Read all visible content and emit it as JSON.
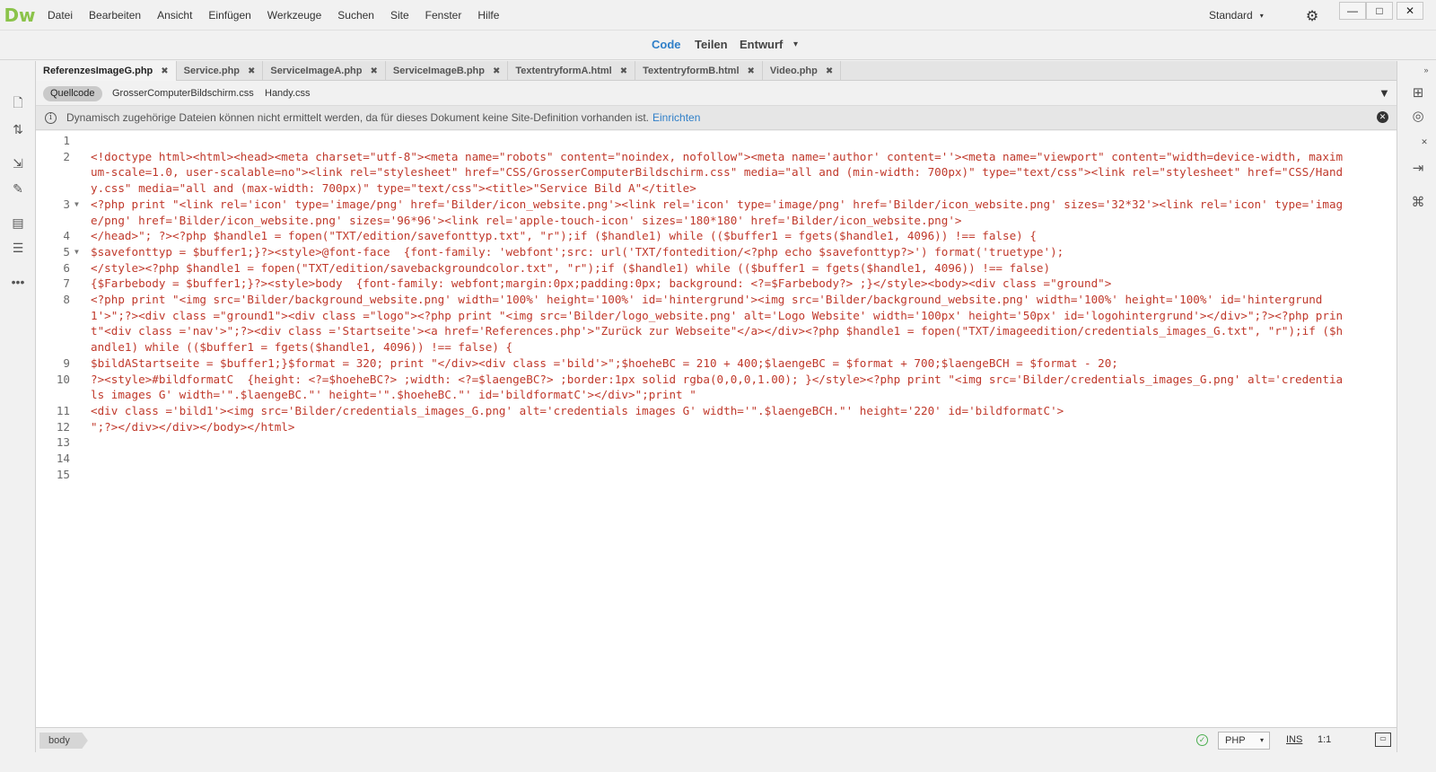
{
  "app": {
    "logo": "Dw"
  },
  "menu": [
    "Datei",
    "Bearbeiten",
    "Ansicht",
    "Einfügen",
    "Werkzeuge",
    "Suchen",
    "Site",
    "Fenster",
    "Hilfe"
  ],
  "workspace": {
    "label": "Standard",
    "caret": "▾"
  },
  "window_controls": {
    "minimize": "—",
    "maximize": "□",
    "close": "✕"
  },
  "view_modes": {
    "code": "Code",
    "split": "Teilen",
    "design": "Entwurf",
    "caret": "▾"
  },
  "tabs": [
    {
      "label": "ReferenzesImageG.php",
      "active": true
    },
    {
      "label": "Service.php"
    },
    {
      "label": "ServiceImageA.php"
    },
    {
      "label": "ServiceImageB.php"
    },
    {
      "label": "TextentryformA.html"
    },
    {
      "label": "TextentryformB.html"
    },
    {
      "label": "Video.php"
    }
  ],
  "related_files": [
    {
      "label": "Quellcode",
      "active": true
    },
    {
      "label": "GrosserComputerBildschirm.css"
    },
    {
      "label": "Handy.css"
    }
  ],
  "info_bar": {
    "message": "Dynamisch zugehörige Dateien können nicht ermittelt werden, da für dieses Dokument keine Site-Definition vorhanden ist.",
    "link": "Einrichten"
  },
  "code_lines": [
    {
      "n": "1",
      "text": ""
    },
    {
      "n": "2",
      "text": "<!doctype html><html><head><meta charset=\"utf-8\"><meta name=\"robots\" content=\"noindex, nofollow\"><meta name='author' content=''><meta name=\"viewport\" content=\"width=device-width, maximum-scale=1.0, user-scalable=no\"><link rel=\"stylesheet\" href=\"CSS/GrosserComputerBildschirm.css\" media=\"all and (min-width: 700px)\" type=\"text/css\"><link rel=\"stylesheet\" href=\"CSS/Handy.css\" media=\"all and (max-width: 700px)\" type=\"text/css\"><title>\"Service Bild A\"</title>"
    },
    {
      "n": "3",
      "text": "<?php print \"<link rel='icon' type='image/png' href='Bilder/icon_website.png'><link rel='icon' type='image/png' href='Bilder/icon_website.png' sizes='32*32'><link rel='icon' type='image/png' href='Bilder/icon_website.png' sizes='96*96'><link rel='apple-touch-icon' sizes='180*180' href='Bilder/icon_website.png'>"
    },
    {
      "n": "4",
      "text": "</head>\"; ?><?php $handle1 = fopen(\"TXT/edition/savefonttyp.txt\", \"r\");if ($handle1) while (($buffer1 = fgets($handle1, 4096)) !== false) {"
    },
    {
      "n": "5",
      "text": "$savefonttyp = $buffer1;}?><style>@font-face  {font-family: 'webfont';src: url('TXT/fontedition/<?php echo $savefonttyp?>') format('truetype');"
    },
    {
      "n": "6",
      "text": "</style><?php $handle1 = fopen(\"TXT/edition/savebackgroundcolor.txt\", \"r\");if ($handle1) while (($buffer1 = fgets($handle1, 4096)) !== false)"
    },
    {
      "n": "7",
      "text": "{$Farbebody = $buffer1;}?><style>body  {font-family: webfont;margin:0px;padding:0px; background: <?=$Farbebody?> ;}</style><body><div class =\"ground\">"
    },
    {
      "n": "8",
      "text": "<?php print \"<img src='Bilder/background_website.png' width='100%' height='100%' id='hintergrund'><img src='Bilder/background_website.png' width='100%' height='100%' id='hintergrund1'>\";?><div class =\"ground1\"><div class =\"logo\"><?php print \"<img src='Bilder/logo_website.png' alt='Logo Website' width='100px' height='50px' id='logohintergrund'></div>\";?><?php print\"<div class ='nav'>\";?><div class ='Startseite'><a href='References.php'>\"Zurück zur Webseite\"</a></div><?php $handle1 = fopen(\"TXT/imageedition/credentials_images_G.txt\", \"r\");if ($handle1) while (($buffer1 = fgets($handle1, 4096)) !== false) {"
    },
    {
      "n": "9",
      "text": "$bildAStartseite = $buffer1;}$format = 320; print \"</div><div class ='bild'>\";$hoeheBC = 210 + 400;$laengeBC = $format + 700;$laengeBCH = $format - 20;"
    },
    {
      "n": "10",
      "text": "?><style>#bildformatC  {height: <?=$hoeheBC?> ;width: <?=$laengeBC?> ;border:1px solid rgba(0,0,0,1.00); }</style><?php print \"<img src='Bilder/credentials_images_G.png' alt='credentials images G' width='\".$laengeBC.\"' height='\".$hoeheBC.\"' id='bildformatC'></div>\";print \""
    },
    {
      "n": "11",
      "text": "<div class ='bild1'><img src='Bilder/credentials_images_G.png' alt='credentials images G' width='\".$laengeBCH.\"' height='220' id='bildformatC'>"
    },
    {
      "n": "12",
      "text": "\";?></div></div></body></html>"
    },
    {
      "n": "13",
      "text": ""
    },
    {
      "n": "14",
      "text": ""
    },
    {
      "n": "15",
      "text": ""
    }
  ],
  "status": {
    "tag": "body",
    "language": "PHP",
    "caret": "▾",
    "mode": "INS",
    "position": "1:1"
  }
}
